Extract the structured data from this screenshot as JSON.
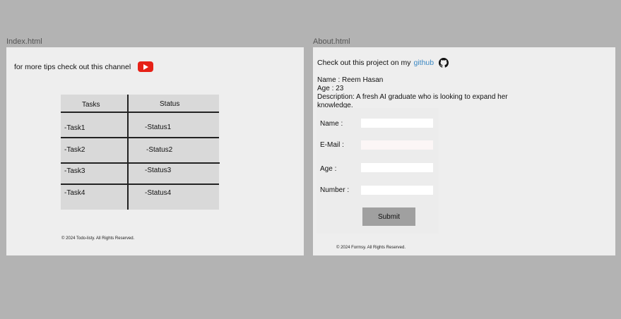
{
  "frames": {
    "index": {
      "label": "Index.html",
      "channel_text": "for more tips check out this channel",
      "table": {
        "headers": [
          "Tasks",
          "Status"
        ],
        "rows": [
          {
            "task": "-Task1",
            "status": "-Status1"
          },
          {
            "task": "-Task2",
            "status": "-Status2"
          },
          {
            "task": "-Task3",
            "status": "-Status3"
          },
          {
            "task": "-Task4",
            "status": "-Status4"
          }
        ]
      },
      "footer": "© 2024 Todo-listy. All Rights Reserved."
    },
    "about": {
      "label": "About.html",
      "project_text": "Check out this project on my",
      "github_link": "github",
      "bio": {
        "name": "Name : Reem Hasan",
        "age": "Age : 23",
        "description": "Description: A fresh AI graduate who is looking to expand her knowledge."
      },
      "form": {
        "name_label": "Name :",
        "email_label": "E-Mail :",
        "age_label": "Age :",
        "number_label": "Number :",
        "submit_label": "Submit"
      },
      "footer": "© 2024 Formsy. All Rights Reserved."
    }
  },
  "colors": {
    "canvas": "#b3b3b3",
    "frame_bg": "#eeeeee",
    "table_bg": "#d9d9d9",
    "youtube_red": "#e62117",
    "link_blue": "#3b88c3",
    "button_bg": "#a0a0a0"
  },
  "icons": [
    "youtube-icon",
    "github-icon"
  ]
}
